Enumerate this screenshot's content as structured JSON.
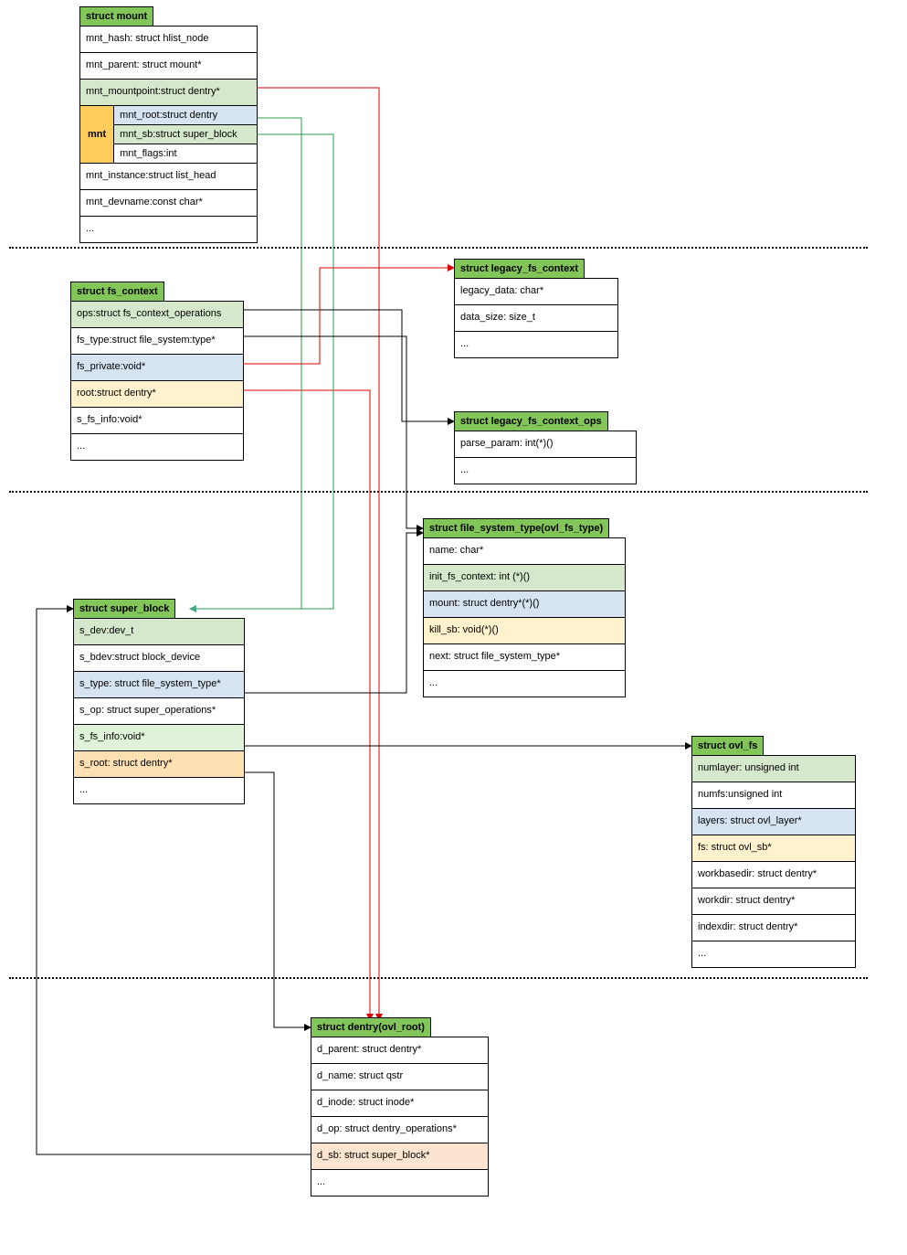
{
  "mount": {
    "title": "struct mount",
    "rows": [
      "mnt_hash: struct hlist_node",
      "mnt_parent: struct mount*",
      "mnt_mountpoint:struct dentry*"
    ],
    "nested_label": "mnt",
    "nested": [
      "mnt_root:struct dentry",
      "mnt_sb:struct super_block",
      "mnt_flags:int"
    ],
    "rows2": [
      "mnt_instance:struct list_head",
      "mnt_devname:const char*",
      "..."
    ]
  },
  "fs_context": {
    "title": "struct fs_context",
    "rows": [
      "ops:struct fs_context_operations",
      "fs_type:struct file_system:type*",
      "fs_private:void*",
      "root:struct dentry*",
      "s_fs_info:void*",
      "..."
    ]
  },
  "legacy_ctx": {
    "title": "struct legacy_fs_context",
    "rows": [
      "legacy_data: char*",
      "data_size: size_t",
      "..."
    ]
  },
  "legacy_ops": {
    "title": "struct legacy_fs_context_ops",
    "rows": [
      "parse_param: int(*)()",
      "..."
    ]
  },
  "super_block": {
    "title": "struct super_block",
    "rows": [
      "s_dev:dev_t",
      "s_bdev:struct block_device",
      "s_type: struct file_system_type*",
      "s_op: struct super_operations*",
      "s_fs_info:void*",
      "s_root: struct dentry*",
      "..."
    ]
  },
  "fs_type": {
    "title": "struct file_system_type(ovl_fs_type)",
    "rows": [
      "name: char*",
      "init_fs_context: int (*)()",
      "mount: struct dentry*(*)()",
      "kill_sb: void(*)()",
      "next: struct file_system_type*",
      "..."
    ]
  },
  "ovl_fs": {
    "title": "struct ovl_fs",
    "rows": [
      "numlayer: unsigned int",
      "numfs:unsigned int",
      "layers: struct ovl_layer*",
      "fs: struct ovl_sb*",
      "workbasedir: struct dentry*",
      "workdir: struct dentry*",
      "indexdir: struct dentry*",
      "..."
    ]
  },
  "dentry": {
    "title": "struct dentry(ovl_root)",
    "rows": [
      "d_parent: struct dentry*",
      "d_name: struct qstr",
      "d_inode: struct inode*",
      "d_op: struct dentry_operations*",
      "d_sb: struct super_block*",
      "..."
    ]
  }
}
